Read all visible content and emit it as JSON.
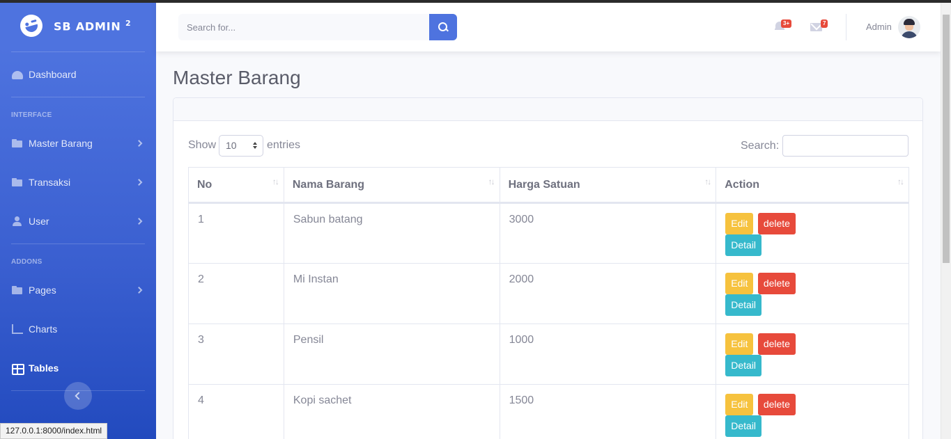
{
  "brand": {
    "name": "SB ADMIN",
    "sup": "2"
  },
  "sidebar": {
    "items": [
      {
        "label": "Dashboard"
      },
      {
        "label": "Master Barang"
      },
      {
        "label": "Transaksi"
      },
      {
        "label": "User"
      },
      {
        "label": "Pages"
      },
      {
        "label": "Charts"
      },
      {
        "label": "Tables"
      }
    ],
    "headings": {
      "interface": "INTERFACE",
      "addons": "ADDONS"
    }
  },
  "topbar": {
    "search_placeholder": "Search for...",
    "alerts_badge": "3+",
    "messages_badge": "7",
    "username": "Admin"
  },
  "page": {
    "title": "Master Barang"
  },
  "datatable": {
    "show_label": "Show",
    "length_value": "10",
    "entries_label": "entries",
    "search_label": "Search:",
    "columns": [
      "No",
      "Nama Barang",
      "Harga Satuan",
      "Action"
    ],
    "rows": [
      {
        "no": "1",
        "nama": "Sabun batang",
        "harga": "3000"
      },
      {
        "no": "2",
        "nama": "Mi Instan",
        "harga": "2000"
      },
      {
        "no": "3",
        "nama": "Pensil",
        "harga": "1000"
      },
      {
        "no": "4",
        "nama": "Kopi sachet",
        "harga": "1500"
      }
    ],
    "actions": {
      "edit": "Edit",
      "delete": "delete",
      "detail": "Detail"
    }
  },
  "status_bar": {
    "url": "127.0.0.1:8000/index.html"
  },
  "colors": {
    "primary": "#4e73df",
    "warning": "#f6c23e",
    "danger": "#e74a3b",
    "info": "#36b9cc"
  }
}
